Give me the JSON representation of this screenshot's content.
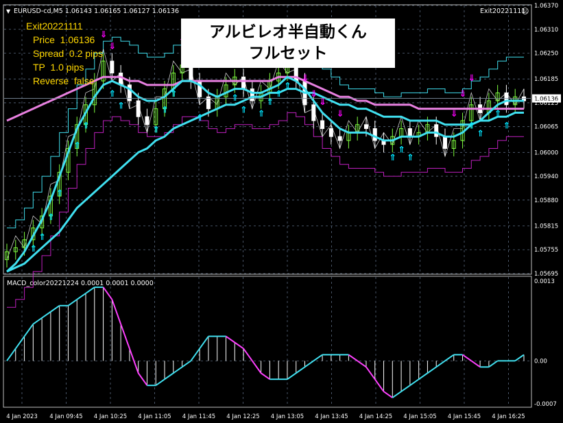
{
  "header": {
    "symbol_line": "EURUSD-cd,M5  1.06143 1.06165 1.06127 1.06136",
    "ea_name": "Exit20221111"
  },
  "banner": {
    "line1": "アルビレオ半自動くん",
    "line2": "フルセット"
  },
  "info_panel": {
    "title": "Exit20221111",
    "price": "Price  1.06136",
    "spread": "Spread  0.2 pips",
    "tp": "TP  1.0 pips",
    "reverse": "Reverse  false"
  },
  "macd_label": "MACD_color20221224 0.0001 0.0001 0.0000",
  "colors": {
    "cyan": "#40e0f0",
    "magenta": "#ff40ff",
    "pink_ma": "#e880e0",
    "bull": "#80ff40",
    "bear": "#ffffff",
    "grid": "#5a6a80",
    "arrow_down": "#ff00ff",
    "arrow_up": "#00e5ff"
  },
  "chart_data": [
    {
      "type": "candlestick",
      "title": "EURUSD-cd,M5",
      "ylim": [
        1.05695,
        1.0637
      ],
      "y_ticks": [
        "1.06370",
        "1.06310",
        "1.06250",
        "1.06185",
        "1.06125",
        "1.06065",
        "1.06000",
        "1.05940",
        "1.05880",
        "1.05815",
        "1.05755",
        "1.05695"
      ],
      "current_price": "1.06136",
      "x_ticks": [
        "4 Jan 2023",
        "4 Jan 09:45",
        "4 Jan 10:25",
        "4 Jan 11:05",
        "4 Jan 11:45",
        "4 Jan 12:25",
        "4 Jan 13:05",
        "4 Jan 13:45",
        "4 Jan 14:25",
        "4 Jan 15:05",
        "4 Jan 15:45",
        "4 Jan 16:25"
      ],
      "close": [
        1.0575,
        1.0576,
        1.0578,
        1.0581,
        1.0584,
        1.0589,
        1.0595,
        1.0601,
        1.0607,
        1.0612,
        1.0618,
        1.0623,
        1.062,
        1.0617,
        1.0613,
        1.0609,
        1.0607,
        1.0611,
        1.0616,
        1.062,
        1.0622,
        1.0618,
        1.0614,
        1.0611,
        1.0614,
        1.0617,
        1.0619,
        1.0616,
        1.0613,
        1.0615,
        1.0618,
        1.062,
        1.0622,
        1.0618,
        1.0612,
        1.0608,
        1.0606,
        1.0604,
        1.0603,
        1.0605,
        1.0607,
        1.0606,
        1.0603,
        1.0602,
        1.0604,
        1.0606,
        1.0604,
        1.0605,
        1.0607,
        1.0604,
        1.0601,
        1.0603,
        1.0608,
        1.0612,
        1.061,
        1.0613,
        1.0615,
        1.0612,
        1.0614,
        1.0613
      ],
      "series": [
        {
          "name": "fast_ma",
          "values": [
            1.057,
            1.0572,
            1.0575,
            1.0579,
            1.0583,
            1.0588,
            1.0594,
            1.06,
            1.0606,
            1.061,
            1.0614,
            1.0617,
            1.0618,
            1.0617,
            1.0616,
            1.0614,
            1.0613,
            1.0613,
            1.0614,
            1.0616,
            1.0618,
            1.0618,
            1.0617,
            1.0615,
            1.0614,
            1.0615,
            1.0616,
            1.0616,
            1.0615,
            1.0615,
            1.0616,
            1.0617,
            1.0619,
            1.0618,
            1.0616,
            1.0613,
            1.061,
            1.0608,
            1.0606,
            1.0605,
            1.0605,
            1.0605,
            1.0604,
            1.0603,
            1.0603,
            1.0604,
            1.0604,
            1.0604,
            1.0605,
            1.0605,
            1.0604,
            1.0604,
            1.0605,
            1.0607,
            1.0608,
            1.061,
            1.0612,
            1.0613,
            1.0613,
            1.0613
          ]
        },
        {
          "name": "slow_ma",
          "values": [
            1.057,
            1.0571,
            1.0572,
            1.0574,
            1.0576,
            1.0578,
            1.058,
            1.0583,
            1.0586,
            1.0588,
            1.059,
            1.0592,
            1.0594,
            1.0596,
            1.0598,
            1.06,
            1.0601,
            1.0603,
            1.0604,
            1.0606,
            1.0607,
            1.0608,
            1.0609,
            1.061,
            1.0611,
            1.0612,
            1.0612,
            1.0613,
            1.0614,
            1.0614,
            1.0615,
            1.0615,
            1.0616,
            1.0616,
            1.0615,
            1.0615,
            1.0614,
            1.0613,
            1.0612,
            1.0612,
            1.0611,
            1.0611,
            1.061,
            1.0609,
            1.0609,
            1.0609,
            1.0608,
            1.0608,
            1.0608,
            1.0608,
            1.0607,
            1.0607,
            1.0607,
            1.0607,
            1.0608,
            1.0608,
            1.0609,
            1.0609,
            1.061,
            1.061
          ]
        },
        {
          "name": "pink_ma",
          "values": [
            1.0608,
            1.0609,
            1.061,
            1.0611,
            1.0612,
            1.0613,
            1.0614,
            1.0615,
            1.0616,
            1.0617,
            1.0618,
            1.0619,
            1.0619,
            1.0619,
            1.0618,
            1.0618,
            1.0617,
            1.0617,
            1.0617,
            1.0617,
            1.0618,
            1.0618,
            1.0618,
            1.0618,
            1.0618,
            1.0618,
            1.0618,
            1.0618,
            1.0618,
            1.0618,
            1.0618,
            1.0619,
            1.0619,
            1.0619,
            1.0618,
            1.0617,
            1.0616,
            1.0615,
            1.0614,
            1.0614,
            1.0613,
            1.0613,
            1.0612,
            1.0612,
            1.0612,
            1.0612,
            1.0612,
            1.0611,
            1.0611,
            1.0611,
            1.0611,
            1.0611,
            1.0611,
            1.0611,
            1.0611,
            1.0611,
            1.0611,
            1.0611,
            1.0611,
            1.0611
          ]
        }
      ]
    },
    {
      "type": "histogram",
      "title": "MACD_color20221224",
      "ylim": [
        -0.0007,
        0.0013
      ],
      "y_ticks": [
        "0.0013",
        "0.00",
        "-0.0007"
      ],
      "values": [
        0.0,
        0.0002,
        0.0004,
        0.0006,
        0.0007,
        0.0008,
        0.0009,
        0.0009,
        0.001,
        0.0011,
        0.0012,
        0.0012,
        0.001,
        0.0006,
        0.0002,
        -0.0002,
        -0.0004,
        -0.0004,
        -0.0003,
        -0.0002,
        -0.0001,
        0.0,
        0.0002,
        0.0004,
        0.0004,
        0.0004,
        0.0003,
        0.0002,
        0.0,
        -0.0002,
        -0.0003,
        -0.0003,
        -0.0003,
        -0.0002,
        -0.0001,
        0.0,
        0.0001,
        0.0001,
        0.0001,
        0.0001,
        0.0,
        -0.0001,
        -0.0003,
        -0.0005,
        -0.0006,
        -0.0005,
        -0.0004,
        -0.0003,
        -0.0002,
        -0.0001,
        0.0,
        0.0001,
        0.0001,
        0.0,
        -0.0001,
        -0.0001,
        0.0,
        0.0,
        0.0,
        0.0001
      ]
    }
  ]
}
